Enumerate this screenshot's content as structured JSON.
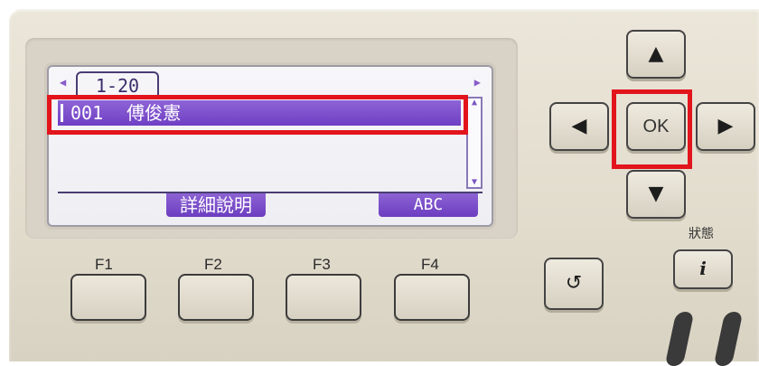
{
  "lcd": {
    "page_tab": "1-20",
    "entry": {
      "number": "001",
      "name": "傅俊憲"
    },
    "softkeys": {
      "f2": "詳細說明",
      "f4": "ABC"
    }
  },
  "function_keys": [
    "F1",
    "F2",
    "F3",
    "F4"
  ],
  "navigation": {
    "up_glyph": "▲",
    "down_glyph": "▼",
    "left_glyph": "◀",
    "right_glyph": "▶",
    "ok_label": "OK"
  },
  "status": {
    "label": "狀態",
    "info_glyph": "i"
  },
  "back_glyph": "↺",
  "highlight_color": "#e2151c",
  "icons": [
    "tab-left-arrow-icon",
    "tab-right-arrow-icon",
    "scroll-up-icon",
    "scroll-down-icon",
    "back-icon",
    "info-icon"
  ]
}
